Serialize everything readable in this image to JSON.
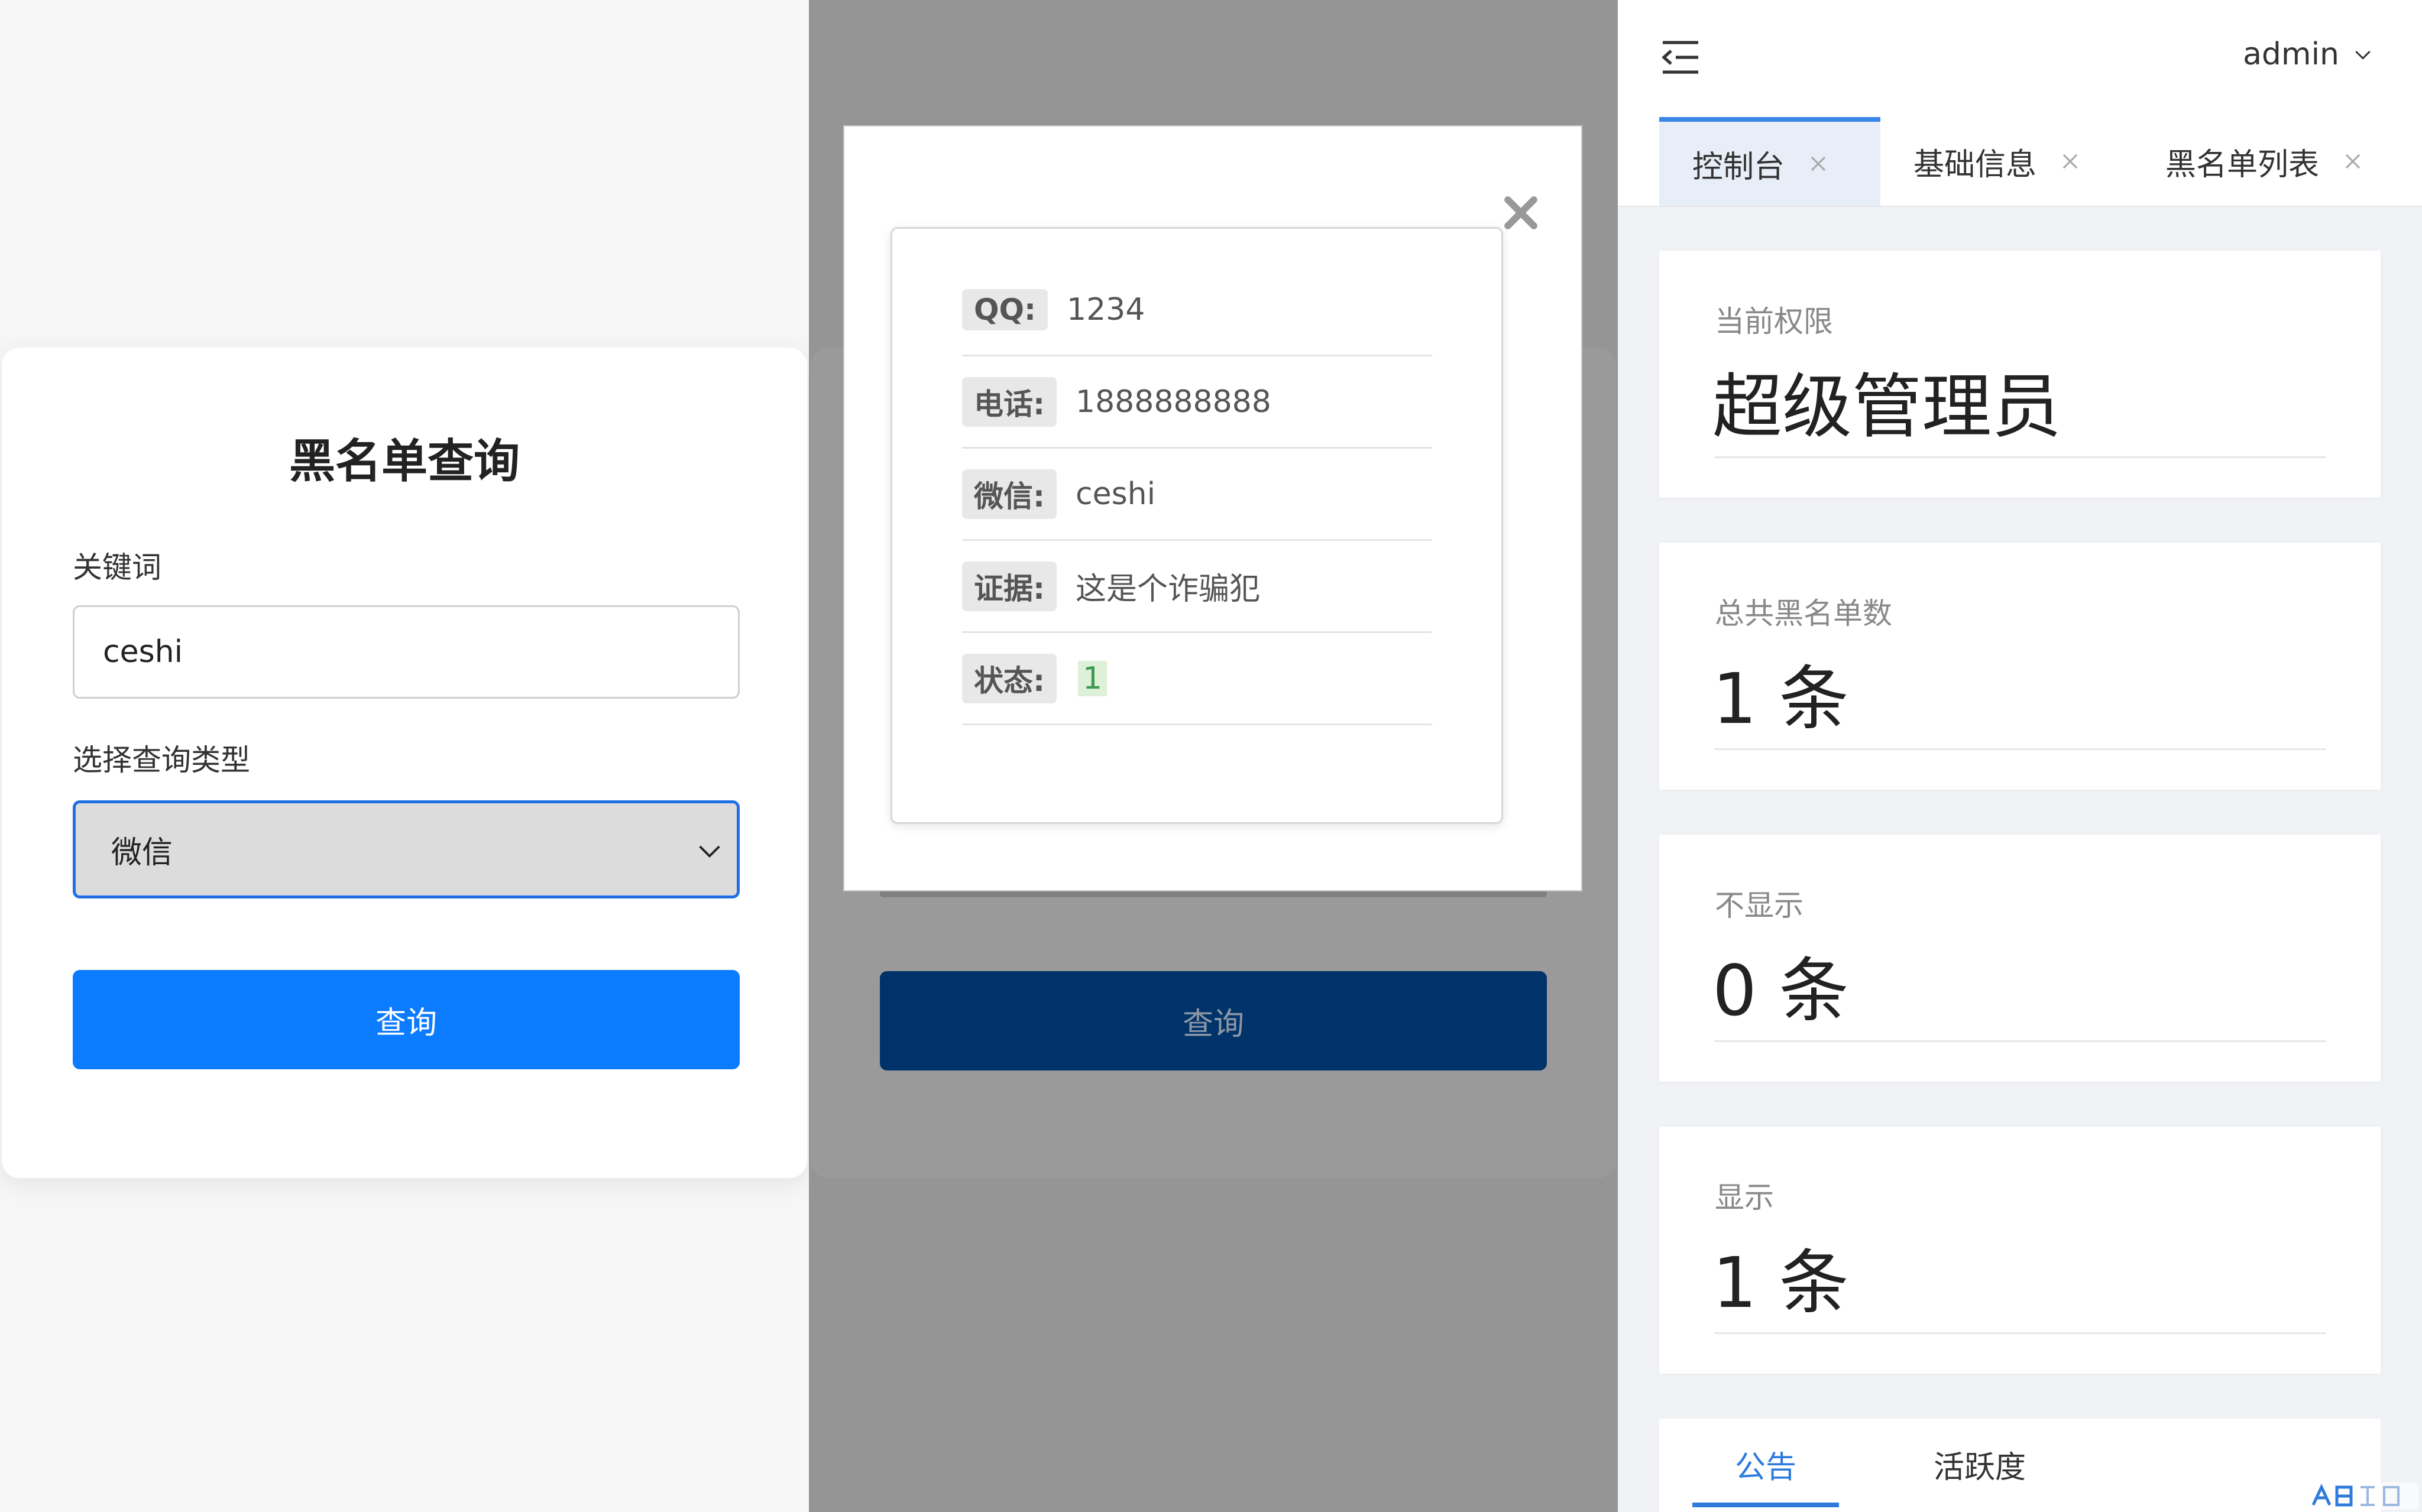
{
  "query_form": {
    "title": "黑名单查询",
    "keyword_label": "关键词",
    "keyword_value": "ceshi",
    "type_label": "选择查询类型",
    "type_selected": "微信",
    "submit_label": "查询"
  },
  "result_modal": {
    "rows": [
      {
        "key": "QQ:",
        "value": "1234"
      },
      {
        "key": "电话:",
        "value": "1888888888"
      },
      {
        "key": "微信:",
        "value": "ceshi"
      },
      {
        "key": "证据:",
        "value": "这是个诈骗犯"
      },
      {
        "key": "状态:",
        "value": "1"
      }
    ],
    "background_button_label": "查询"
  },
  "admin": {
    "user": "admin",
    "tabs": [
      {
        "label": "控制台",
        "active": true
      },
      {
        "label": "基础信息",
        "active": false
      },
      {
        "label": "黑名单列表",
        "active": false
      }
    ],
    "stats": [
      {
        "label": "当前权限",
        "value": "超级管理员"
      },
      {
        "label": "总共黑名单数",
        "value": "1 条"
      },
      {
        "label": "不显示",
        "value": "0 条"
      },
      {
        "label": "显示",
        "value": "1 条"
      }
    ],
    "bottom_tabs": [
      {
        "label": "公告",
        "active": true
      },
      {
        "label": "活跃度",
        "active": false
      }
    ]
  },
  "colors": {
    "primary": "#0b7bff",
    "dim_button": "#00336a",
    "active_tab": "#3a86e8",
    "status_highlight": "#dff0d8"
  }
}
